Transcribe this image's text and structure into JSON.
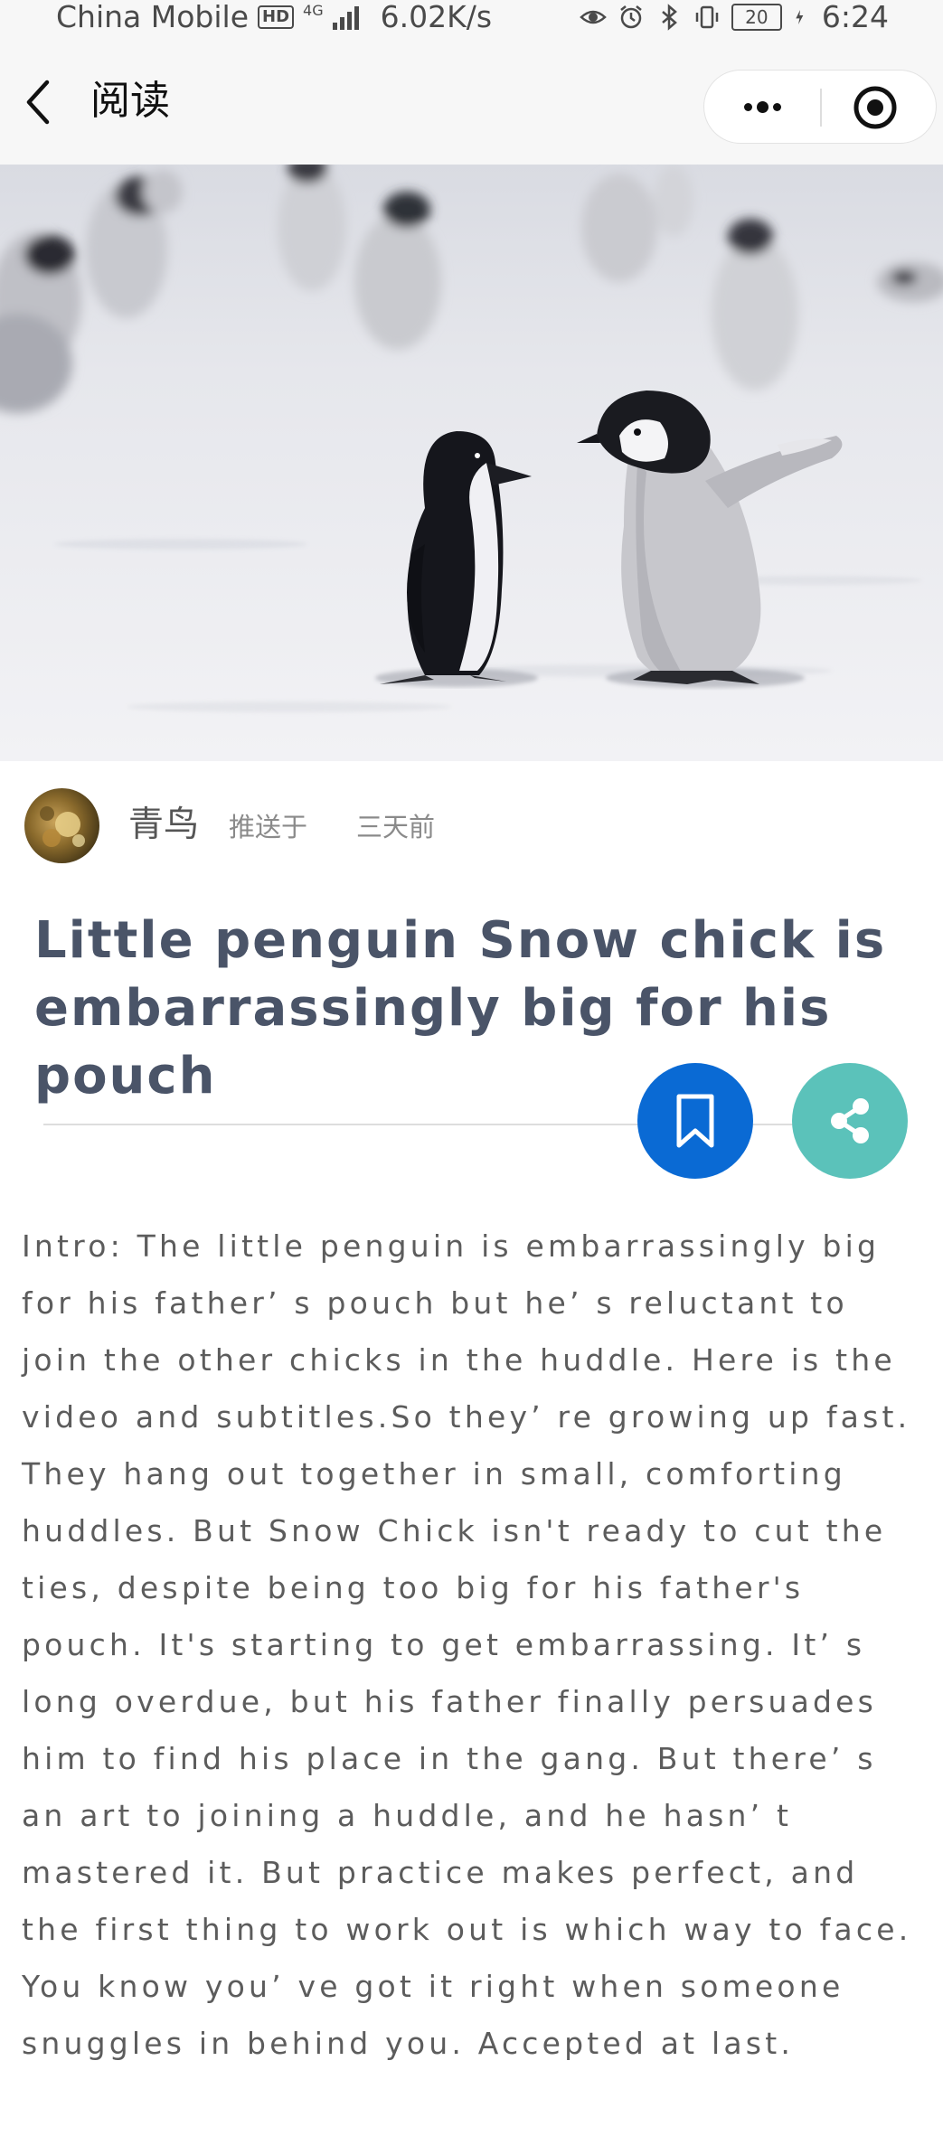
{
  "status_bar": {
    "carrier": "China Mobile",
    "hd_badge": "HD",
    "network": "4G",
    "speed": "6.02K/s",
    "battery": "20",
    "time": "6:24",
    "icons": [
      "eye-icon",
      "alarm-icon",
      "bluetooth-icon",
      "vibrate-icon",
      "battery-icon",
      "charging-icon"
    ]
  },
  "nav": {
    "back_icon": "chevron-left-icon",
    "title": "阅读",
    "more_icon": "more-dots-icon",
    "close_icon": "target-close-icon"
  },
  "hero": {
    "icon": "penguin-photo"
  },
  "author": {
    "name": "青鸟",
    "pushed_label": "推送于",
    "time_ago": "三天前"
  },
  "article": {
    "title": "Little penguin Snow chick is embarrassingly big for his pouch",
    "body": "Intro: The little penguin is embarrassingly big for his father’ s pouch but he’ s reluctant to join the other chicks in the huddle. Here is the video and subtitles.So they’ re growing up fast. They hang out together in small, comforting huddles. But Snow Chick isn't ready to cut the ties, despite being too big for his father's pouch. It's starting to get embarrassing. It’ s long overdue, but his father finally persuades him to find his place in the gang. But there’ s an art to joining a huddle, and he hasn’ t mastered it. But practice makes perfect, and the first thing to work out is which way to face. You know you’ ve got it right when someone snuggles in behind you. Accepted at last."
  },
  "actions": {
    "bookmark_icon": "bookmark-icon",
    "share_icon": "share-icon"
  },
  "colors": {
    "title": "#4a5468",
    "body": "#5c5c5c",
    "bookmark_bg": "#0a6ad4",
    "share_bg": "#5bc2ba",
    "nav_bg": "#f7f7f7"
  }
}
